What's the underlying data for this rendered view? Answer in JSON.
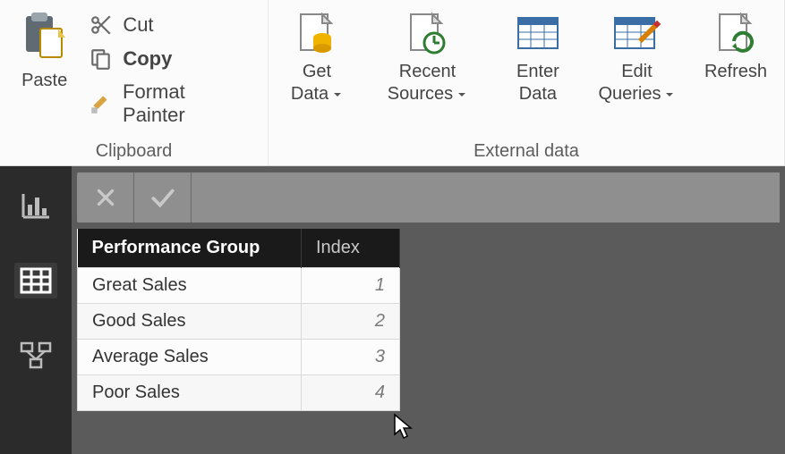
{
  "ribbon": {
    "clipboard": {
      "group_label": "Clipboard",
      "paste": "Paste",
      "cut": "Cut",
      "copy": "Copy",
      "format_painter": "Format Painter"
    },
    "external": {
      "group_label": "External data",
      "get_data": "Get Data",
      "recent_sources": "Recent Sources",
      "enter_data": "Enter Data",
      "edit_queries": "Edit Queries",
      "refresh": "Refresh"
    }
  },
  "formula_bar": {
    "value": ""
  },
  "table": {
    "columns": {
      "group": "Performance Group",
      "index": "Index"
    },
    "rows": [
      {
        "group": "Great Sales",
        "index": "1"
      },
      {
        "group": "Good Sales",
        "index": "2"
      },
      {
        "group": "Average Sales",
        "index": "3"
      },
      {
        "group": "Poor Sales",
        "index": "4"
      }
    ]
  }
}
